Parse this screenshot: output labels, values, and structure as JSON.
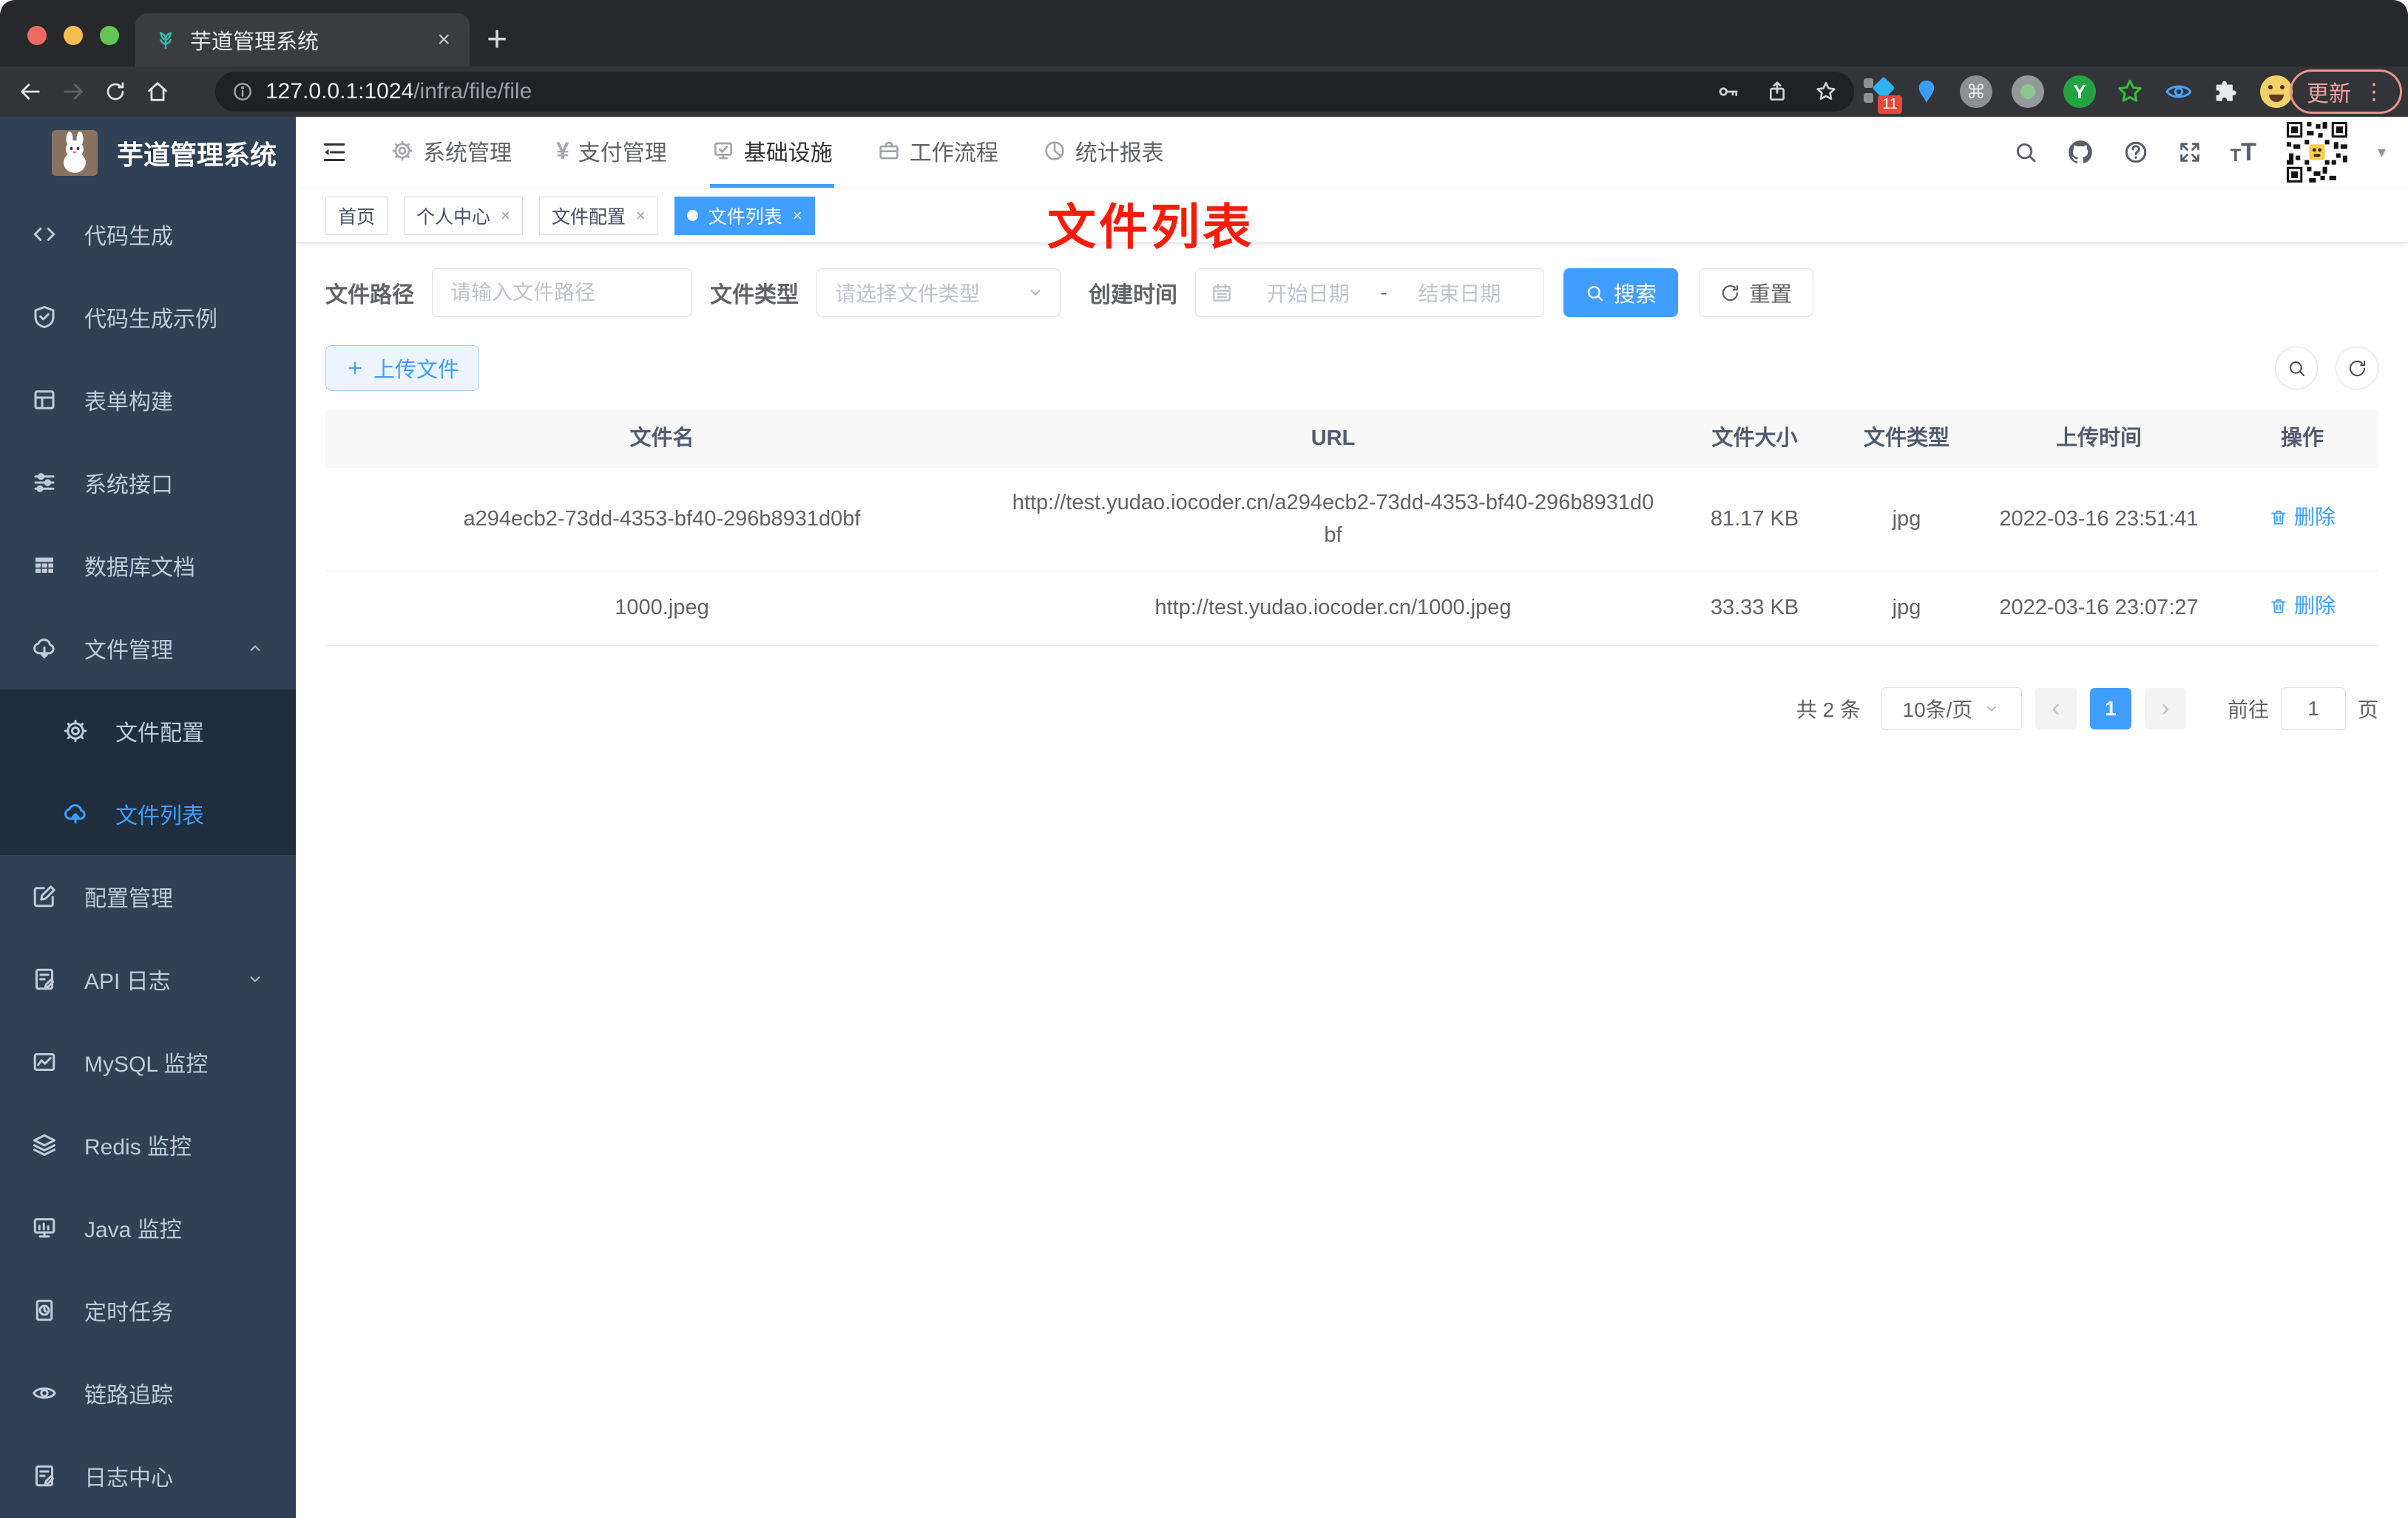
{
  "browser": {
    "tab_title": "芋道管理系统",
    "close_tab": "×",
    "new_tab": "+",
    "url_host": "127.0.0.1:1024",
    "url_path": "/infra/file/file",
    "extension_badge": "11",
    "cmd_glyph": "⌘",
    "letter_y": "Y",
    "update_button": "更新",
    "menu_dots": "⋮"
  },
  "sidebar": {
    "logo_title": "芋道管理系统",
    "items": [
      {
        "label": "代码生成",
        "icon": "code-icon"
      },
      {
        "label": "代码生成示例",
        "icon": "shield-check-icon"
      },
      {
        "label": "表单构建",
        "icon": "form-grid-icon"
      },
      {
        "label": "系统接口",
        "icon": "sliders-icon"
      },
      {
        "label": "数据库文档",
        "icon": "table-icon"
      },
      {
        "label": "文件管理",
        "icon": "cloud-download-icon"
      },
      {
        "label": "文件配置",
        "icon": "gear-icon"
      },
      {
        "label": "文件列表",
        "icon": "cloud-upload-icon"
      },
      {
        "label": "配置管理",
        "icon": "edit-square-icon"
      },
      {
        "label": "API 日志",
        "icon": "document-edit-icon"
      },
      {
        "label": "MySQL 监控",
        "icon": "chart-box-icon"
      },
      {
        "label": "Redis 监控",
        "icon": "layers-icon"
      },
      {
        "label": "Java 监控",
        "icon": "monitor-icon"
      },
      {
        "label": "定时任务",
        "icon": "timer-icon"
      },
      {
        "label": "链路追踪",
        "icon": "eye-icon"
      },
      {
        "label": "日志中心",
        "icon": "document-edit-icon"
      }
    ]
  },
  "header": {
    "nav": [
      {
        "label": "系统管理",
        "icon": "gear-icon"
      },
      {
        "label": "支付管理",
        "icon": "yen-icon",
        "glyph": "¥"
      },
      {
        "label": "基础设施",
        "icon": "monitor-check-icon"
      },
      {
        "label": "工作流程",
        "icon": "briefcase-icon"
      },
      {
        "label": "统计报表",
        "icon": "chart-pie-icon"
      }
    ],
    "caret": "▾",
    "font_small": "T",
    "font_large": "T"
  },
  "tags": [
    {
      "label": "首页"
    },
    {
      "label": "个人中心",
      "close": "×"
    },
    {
      "label": "文件配置",
      "close": "×"
    },
    {
      "label": "文件列表",
      "close": "×"
    }
  ],
  "annotation": "文件列表",
  "filters": {
    "path_label": "文件路径",
    "path_placeholder": "请输入文件路径",
    "type_label": "文件类型",
    "type_placeholder": "请选择文件类型",
    "date_label": "创建时间",
    "date_start_placeholder": "开始日期",
    "date_separator": "-",
    "date_end_placeholder": "结束日期",
    "search_label": "搜索",
    "reset_label": "重置"
  },
  "toolbar": {
    "upload_label": "上传文件"
  },
  "table": {
    "headers": [
      "文件名",
      "URL",
      "文件大小",
      "文件类型",
      "上传时间",
      "操作"
    ],
    "rows": [
      {
        "name": "a294ecb2-73dd-4353-bf40-296b8931d0bf",
        "url": "http://test.yudao.iocoder.cn/a294ecb2-73dd-4353-bf40-296b8931d0bf",
        "size": "81.17 KB",
        "type": "jpg",
        "time": "2022-03-16 23:51:41",
        "action": "删除"
      },
      {
        "name": "1000.jpeg",
        "url": "http://test.yudao.iocoder.cn/1000.jpeg",
        "size": "33.33 KB",
        "type": "jpg",
        "time": "2022-03-16 23:07:27",
        "action": "删除"
      }
    ]
  },
  "pagination": {
    "total": "共 2 条",
    "per_page": "10条/页",
    "prev": "‹",
    "page": "1",
    "next": "›",
    "goto_label": "前往",
    "goto_value": "1",
    "page_unit": "页"
  },
  "colors": {
    "accent": "#409eff",
    "sidebar_bg": "#304156",
    "submenu_bg": "#1f2d3d",
    "active_tag": "#409eff",
    "annotation_red": "#f51d0a"
  }
}
